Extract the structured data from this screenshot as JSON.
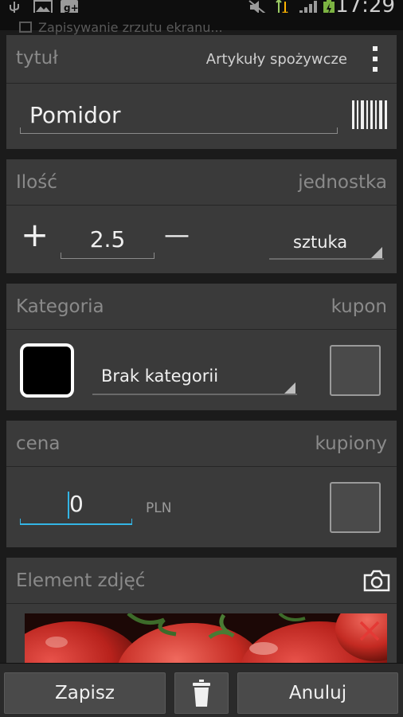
{
  "statusbar": {
    "time": "17:29",
    "notification": "Zapisywanie zrzutu ekranu..."
  },
  "title_card": {
    "label": "tytuł",
    "category_value": "Artykuły spożywcze",
    "name_value": "Pomidor"
  },
  "quantity_card": {
    "label": "Ilość",
    "unit_label": "jednostka",
    "plus": "+",
    "minus": "—",
    "amount": "2.5",
    "unit_value": "sztuka"
  },
  "category_card": {
    "label": "Kategoria",
    "coupon_label": "kupon",
    "category_value": "Brak kategorii"
  },
  "price_card": {
    "label": "cena",
    "bought_label": "kupiony",
    "price_value": "0",
    "currency": "PLN"
  },
  "photo_card": {
    "label": "Element zdjęć"
  },
  "buttons": {
    "save": "Zapisz",
    "cancel": "Anuluj"
  },
  "colors": {
    "accent": "#33b5e5",
    "delete": "#e53935",
    "card": "#3a3a3a"
  },
  "icons": [
    "usb-icon",
    "gallery-icon",
    "gplus-icon",
    "mute-icon",
    "data-icon",
    "signal-icon",
    "battery-icon",
    "more-icon",
    "barcode-icon",
    "camera-icon",
    "delete-icon",
    "trash-icon"
  ]
}
